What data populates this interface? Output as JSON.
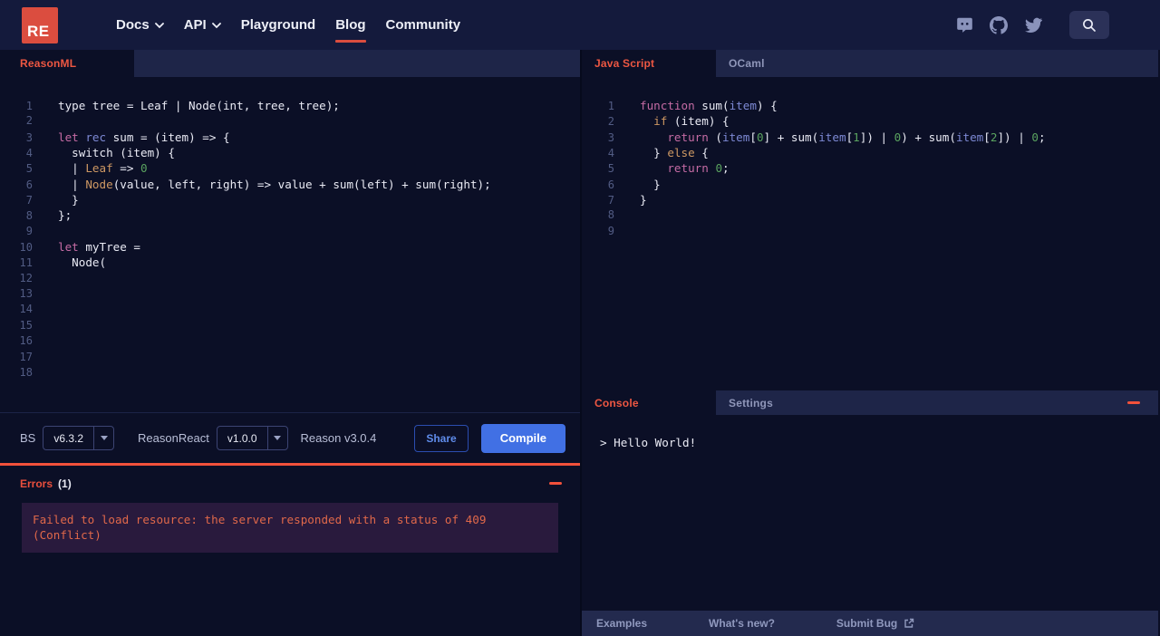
{
  "nav": {
    "logo_text": "RE",
    "items": [
      {
        "label": "Docs",
        "chevron": true,
        "active": false
      },
      {
        "label": "API",
        "chevron": true,
        "active": false
      },
      {
        "label": "Playground",
        "chevron": false,
        "active": false
      },
      {
        "label": "Blog",
        "chevron": false,
        "active": true
      },
      {
        "label": "Community",
        "chevron": false,
        "active": false
      }
    ],
    "icons": [
      "discord-icon",
      "github-icon",
      "twitter-icon",
      "search-icon"
    ]
  },
  "left_pane": {
    "tab_label": "ReasonML",
    "editor": {
      "language": "reason",
      "total_lines": 18,
      "lines": [
        [
          [
            "p",
            "type tree = Leaf | Node(int, tree, tree);"
          ]
        ],
        [],
        [
          [
            "k",
            "let"
          ],
          [
            "p",
            " "
          ],
          [
            "b",
            "rec"
          ],
          [
            "p",
            " sum = (item) => {"
          ]
        ],
        [
          [
            "p",
            "  switch (item) {"
          ]
        ],
        [
          [
            "p",
            "  | "
          ],
          [
            "o",
            "Leaf"
          ],
          [
            "p",
            " => "
          ],
          [
            "n",
            "0"
          ]
        ],
        [
          [
            "p",
            "  | "
          ],
          [
            "o",
            "Node"
          ],
          [
            "p",
            "(value, left, right) => value + sum(left) + sum(right);"
          ]
        ],
        [
          [
            "p",
            "  }"
          ]
        ],
        [
          [
            "p",
            "};"
          ]
        ],
        [],
        [
          [
            "k",
            "let"
          ],
          [
            "p",
            " myTree ="
          ]
        ],
        [
          [
            "p",
            "  Node("
          ]
        ],
        [],
        [],
        [],
        [],
        [],
        [],
        []
      ]
    },
    "toolbar": {
      "bs_label": "BS",
      "bs_version": "v6.3.2",
      "reasonreact_label": "ReasonReact",
      "reasonreact_version": "v1.0.0",
      "reason_version": "Reason v3.0.4",
      "share_label": "Share",
      "compile_label": "Compile"
    },
    "errors": {
      "title": "Errors",
      "count": "(1)",
      "message": "Failed to load resource: the server responded with a status of 409 (Conflict)"
    }
  },
  "right_pane": {
    "tabs": [
      {
        "label": "Java Script",
        "active": true
      },
      {
        "label": "OCaml",
        "active": false
      }
    ],
    "editor": {
      "language": "javascript",
      "total_lines": 9,
      "lines": [
        [
          [
            "k",
            "function"
          ],
          [
            "p",
            " sum("
          ],
          [
            "b",
            "item"
          ],
          [
            "p",
            ") {"
          ]
        ],
        [
          [
            "p",
            "  "
          ],
          [
            "o",
            "if"
          ],
          [
            "p",
            " (item) {"
          ]
        ],
        [
          [
            "p",
            "    "
          ],
          [
            "k",
            "return"
          ],
          [
            "p",
            " ("
          ],
          [
            "b",
            "item"
          ],
          [
            "p",
            "["
          ],
          [
            "n",
            "0"
          ],
          [
            "p",
            "] + sum("
          ],
          [
            "b",
            "item"
          ],
          [
            "p",
            "["
          ],
          [
            "n",
            "1"
          ],
          [
            "p",
            "]) | "
          ],
          [
            "n",
            "0"
          ],
          [
            "p",
            ") + sum("
          ],
          [
            "b",
            "item"
          ],
          [
            "p",
            "["
          ],
          [
            "n",
            "2"
          ],
          [
            "p",
            "]) | "
          ],
          [
            "n",
            "0"
          ],
          [
            "p",
            ";"
          ]
        ],
        [
          [
            "p",
            "  } "
          ],
          [
            "o",
            "else"
          ],
          [
            "p",
            " {"
          ]
        ],
        [
          [
            "p",
            "    "
          ],
          [
            "k",
            "return"
          ],
          [
            "p",
            " "
          ],
          [
            "n",
            "0"
          ],
          [
            "p",
            ";"
          ]
        ],
        [
          [
            "p",
            "  }"
          ]
        ],
        [
          [
            "p",
            "}"
          ]
        ],
        [],
        []
      ]
    },
    "console": {
      "tabs": [
        {
          "label": "Console",
          "active": true
        },
        {
          "label": "Settings",
          "active": false
        }
      ],
      "output": "> Hello World!"
    },
    "footer_links": [
      "Examples",
      "What's new?",
      "Submit Bug"
    ]
  },
  "colors": {
    "accent_orange": "#ED5742",
    "logo_orange": "#DB4D3F",
    "error_border_orange": "#F2513B",
    "compile_blue": "#4170E4",
    "error_text": "#E0684A",
    "editor_bg": "#0B0F26",
    "nav_bg": "#141A3C",
    "tab_strip_bg": "#1E2548"
  }
}
